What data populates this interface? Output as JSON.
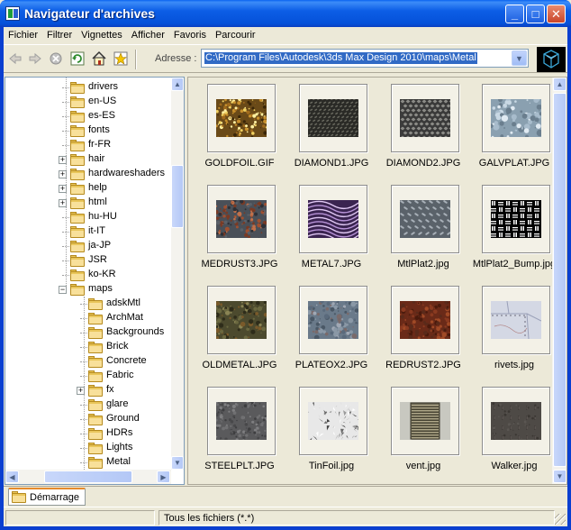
{
  "window": {
    "title": "Navigateur d'archives",
    "min_symbol": "_",
    "max_symbol": "□",
    "close_symbol": "✕"
  },
  "menu": [
    "Fichier",
    "Filtrer",
    "Vignettes",
    "Afficher",
    "Favoris",
    "Parcourir"
  ],
  "toolbar": {
    "address_label": "Adresse :",
    "address_value": "C:\\Program Files\\Autodesk\\3ds Max Design 2010\\maps\\Metal",
    "icons": [
      "back-arrow-icon",
      "forward-arrow-icon",
      "stop-icon",
      "refresh-icon",
      "home-icon",
      "favorites-icon"
    ]
  },
  "tree": {
    "items": [
      {
        "label": "drivers",
        "level": 0,
        "expander": ""
      },
      {
        "label": "en-US",
        "level": 0,
        "expander": ""
      },
      {
        "label": "es-ES",
        "level": 0,
        "expander": ""
      },
      {
        "label": "fonts",
        "level": 0,
        "expander": ""
      },
      {
        "label": "fr-FR",
        "level": 0,
        "expander": ""
      },
      {
        "label": "hair",
        "level": 0,
        "expander": "+"
      },
      {
        "label": "hardwareshaders",
        "level": 0,
        "expander": "+"
      },
      {
        "label": "help",
        "level": 0,
        "expander": "+"
      },
      {
        "label": "html",
        "level": 0,
        "expander": "+"
      },
      {
        "label": "hu-HU",
        "level": 0,
        "expander": ""
      },
      {
        "label": "it-IT",
        "level": 0,
        "expander": ""
      },
      {
        "label": "ja-JP",
        "level": 0,
        "expander": ""
      },
      {
        "label": "JSR",
        "level": 0,
        "expander": ""
      },
      {
        "label": "ko-KR",
        "level": 0,
        "expander": ""
      },
      {
        "label": "maps",
        "level": 0,
        "expander": "-"
      },
      {
        "label": "adskMtl",
        "level": 1,
        "expander": ""
      },
      {
        "label": "ArchMat",
        "level": 1,
        "expander": ""
      },
      {
        "label": "Backgrounds",
        "level": 1,
        "expander": ""
      },
      {
        "label": "Brick",
        "level": 1,
        "expander": ""
      },
      {
        "label": "Concrete",
        "level": 1,
        "expander": ""
      },
      {
        "label": "Fabric",
        "level": 1,
        "expander": ""
      },
      {
        "label": "fx",
        "level": 1,
        "expander": "+"
      },
      {
        "label": "glare",
        "level": 1,
        "expander": ""
      },
      {
        "label": "Ground",
        "level": 1,
        "expander": ""
      },
      {
        "label": "HDRs",
        "level": 1,
        "expander": ""
      },
      {
        "label": "Lights",
        "level": 1,
        "expander": ""
      },
      {
        "label": "Metal",
        "level": 1,
        "expander": ""
      }
    ]
  },
  "thumbnails": [
    {
      "name": "GOLDFOIL.GIF",
      "texture": "goldfoil"
    },
    {
      "name": "DIAMOND1.JPG",
      "texture": "diamond1"
    },
    {
      "name": "DIAMOND2.JPG",
      "texture": "diamond2"
    },
    {
      "name": "GALVPLAT.JPG",
      "texture": "galvplat"
    },
    {
      "name": "MEDRUST3.JPG",
      "texture": "medrust3"
    },
    {
      "name": "METAL7.JPG",
      "texture": "metal7"
    },
    {
      "name": "MtlPlat2.jpg",
      "texture": "mtlplat2"
    },
    {
      "name": "MtlPlat2_Bump.jpg",
      "texture": "mtlplat2bump"
    },
    {
      "name": "OLDMETAL.JPG",
      "texture": "oldmetal"
    },
    {
      "name": "PLATEOX2.JPG",
      "texture": "plateox2"
    },
    {
      "name": "REDRUST2.JPG",
      "texture": "redrust2"
    },
    {
      "name": "rivets.jpg",
      "texture": "rivets"
    },
    {
      "name": "STEELPLT.JPG",
      "texture": "steelplt"
    },
    {
      "name": "TinFoil.jpg",
      "texture": "tinfoil"
    },
    {
      "name": "vent.jpg",
      "texture": "vent"
    },
    {
      "name": "Walker.jpg",
      "texture": "walker"
    }
  ],
  "tabs": {
    "start": "Démarrage"
  },
  "status": {
    "filter": "Tous les fichiers (*.*)"
  }
}
